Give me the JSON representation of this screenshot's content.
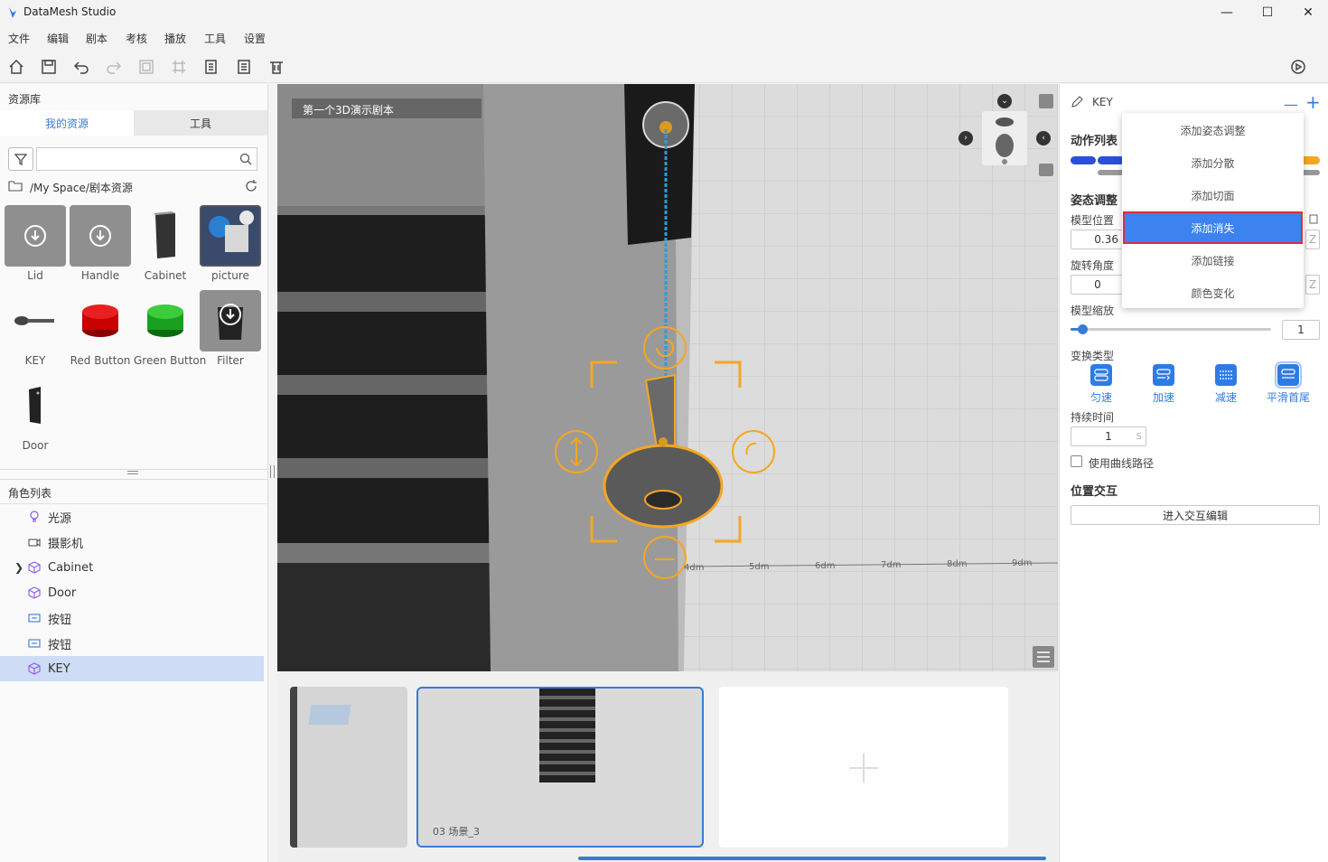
{
  "app": {
    "title": "DataMesh Studio"
  },
  "menu": [
    "文件",
    "编辑",
    "剧本",
    "考核",
    "播放",
    "工具",
    "设置"
  ],
  "left_panel": {
    "title": "资源库",
    "tabs": [
      "我的资源",
      "工具"
    ],
    "search_placeholder": "",
    "path": "/My Space/剧本资源",
    "assets": [
      {
        "label": "Lid"
      },
      {
        "label": "Handle"
      },
      {
        "label": "Cabinet"
      },
      {
        "label": "picture"
      },
      {
        "label": "KEY"
      },
      {
        "label": "Red Button"
      },
      {
        "label": "Green Button"
      },
      {
        "label": "Filter"
      },
      {
        "label": "Door"
      }
    ],
    "roles_title": "角色列表",
    "roles": [
      {
        "label": "光源",
        "icon": "bulb-icon"
      },
      {
        "label": "摄影机",
        "icon": "camera-icon"
      },
      {
        "label": "Cabinet",
        "icon": "cube-icon"
      },
      {
        "label": "Door",
        "icon": "cube-icon"
      },
      {
        "label": "按钮",
        "icon": "button-icon"
      },
      {
        "label": "按钮",
        "icon": "button-icon"
      },
      {
        "label": "KEY",
        "icon": "cube-icon"
      }
    ]
  },
  "viewport": {
    "scene_title": "第一个3D演示剧本",
    "ruler_labels": [
      "4dm",
      "5dm",
      "6dm",
      "7dm",
      "8dm",
      "9dm"
    ]
  },
  "scenes": [
    {
      "label": ""
    },
    {
      "label": "03  场景_3"
    }
  ],
  "right_panel": {
    "object_name": "KEY",
    "action_list_title": "动作列表",
    "pose_title": "姿态调整",
    "position_label": "模型位置",
    "position_value": "0.36",
    "position_axis": "Z",
    "rotation_label": "旋转角度",
    "rotation_value": "0",
    "rotation_axis": "Z",
    "scale_label": "模型缩放",
    "scale_value": "1",
    "scale_fraction": 0.06,
    "transform_label": "变换类型",
    "transform_modes": [
      "匀速",
      "加速",
      "减速",
      "平滑首尾"
    ],
    "duration_label": "持续时间",
    "duration_value": "1",
    "duration_unit": "S",
    "curve_label": "使用曲线路径",
    "interaction_title": "位置交互",
    "interaction_button": "进入交互编辑"
  },
  "dropdown": {
    "items": [
      "添加姿态调整",
      "添加分散",
      "添加切面",
      "添加消失",
      "添加链接",
      "颜色变化"
    ],
    "highlighted": "添加消失"
  },
  "colors": {
    "accent": "#2f7be5",
    "selection": "#cfdcf5",
    "gizmo": "#f5a623"
  }
}
